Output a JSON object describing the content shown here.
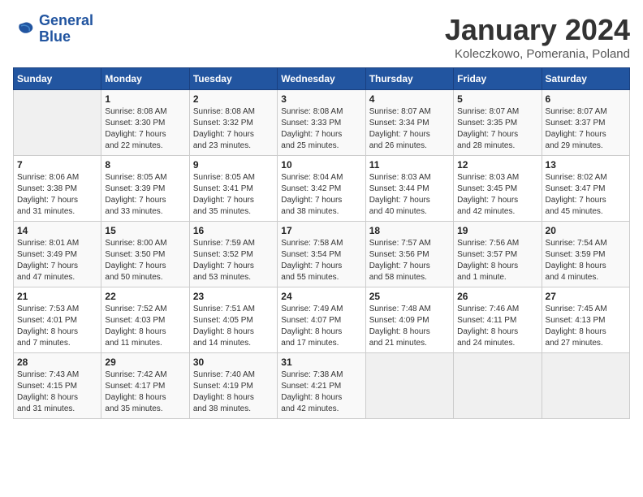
{
  "logo": {
    "line1": "General",
    "line2": "Blue"
  },
  "title": "January 2024",
  "subtitle": "Koleczkowo, Pomerania, Poland",
  "days_of_week": [
    "Sunday",
    "Monday",
    "Tuesday",
    "Wednesday",
    "Thursday",
    "Friday",
    "Saturday"
  ],
  "weeks": [
    [
      {
        "num": "",
        "info": ""
      },
      {
        "num": "1",
        "info": "Sunrise: 8:08 AM\nSunset: 3:30 PM\nDaylight: 7 hours\nand 22 minutes."
      },
      {
        "num": "2",
        "info": "Sunrise: 8:08 AM\nSunset: 3:32 PM\nDaylight: 7 hours\nand 23 minutes."
      },
      {
        "num": "3",
        "info": "Sunrise: 8:08 AM\nSunset: 3:33 PM\nDaylight: 7 hours\nand 25 minutes."
      },
      {
        "num": "4",
        "info": "Sunrise: 8:07 AM\nSunset: 3:34 PM\nDaylight: 7 hours\nand 26 minutes."
      },
      {
        "num": "5",
        "info": "Sunrise: 8:07 AM\nSunset: 3:35 PM\nDaylight: 7 hours\nand 28 minutes."
      },
      {
        "num": "6",
        "info": "Sunrise: 8:07 AM\nSunset: 3:37 PM\nDaylight: 7 hours\nand 29 minutes."
      }
    ],
    [
      {
        "num": "7",
        "info": "Sunrise: 8:06 AM\nSunset: 3:38 PM\nDaylight: 7 hours\nand 31 minutes."
      },
      {
        "num": "8",
        "info": "Sunrise: 8:05 AM\nSunset: 3:39 PM\nDaylight: 7 hours\nand 33 minutes."
      },
      {
        "num": "9",
        "info": "Sunrise: 8:05 AM\nSunset: 3:41 PM\nDaylight: 7 hours\nand 35 minutes."
      },
      {
        "num": "10",
        "info": "Sunrise: 8:04 AM\nSunset: 3:42 PM\nDaylight: 7 hours\nand 38 minutes."
      },
      {
        "num": "11",
        "info": "Sunrise: 8:03 AM\nSunset: 3:44 PM\nDaylight: 7 hours\nand 40 minutes."
      },
      {
        "num": "12",
        "info": "Sunrise: 8:03 AM\nSunset: 3:45 PM\nDaylight: 7 hours\nand 42 minutes."
      },
      {
        "num": "13",
        "info": "Sunrise: 8:02 AM\nSunset: 3:47 PM\nDaylight: 7 hours\nand 45 minutes."
      }
    ],
    [
      {
        "num": "14",
        "info": "Sunrise: 8:01 AM\nSunset: 3:49 PM\nDaylight: 7 hours\nand 47 minutes."
      },
      {
        "num": "15",
        "info": "Sunrise: 8:00 AM\nSunset: 3:50 PM\nDaylight: 7 hours\nand 50 minutes."
      },
      {
        "num": "16",
        "info": "Sunrise: 7:59 AM\nSunset: 3:52 PM\nDaylight: 7 hours\nand 53 minutes."
      },
      {
        "num": "17",
        "info": "Sunrise: 7:58 AM\nSunset: 3:54 PM\nDaylight: 7 hours\nand 55 minutes."
      },
      {
        "num": "18",
        "info": "Sunrise: 7:57 AM\nSunset: 3:56 PM\nDaylight: 7 hours\nand 58 minutes."
      },
      {
        "num": "19",
        "info": "Sunrise: 7:56 AM\nSunset: 3:57 PM\nDaylight: 8 hours\nand 1 minute."
      },
      {
        "num": "20",
        "info": "Sunrise: 7:54 AM\nSunset: 3:59 PM\nDaylight: 8 hours\nand 4 minutes."
      }
    ],
    [
      {
        "num": "21",
        "info": "Sunrise: 7:53 AM\nSunset: 4:01 PM\nDaylight: 8 hours\nand 7 minutes."
      },
      {
        "num": "22",
        "info": "Sunrise: 7:52 AM\nSunset: 4:03 PM\nDaylight: 8 hours\nand 11 minutes."
      },
      {
        "num": "23",
        "info": "Sunrise: 7:51 AM\nSunset: 4:05 PM\nDaylight: 8 hours\nand 14 minutes."
      },
      {
        "num": "24",
        "info": "Sunrise: 7:49 AM\nSunset: 4:07 PM\nDaylight: 8 hours\nand 17 minutes."
      },
      {
        "num": "25",
        "info": "Sunrise: 7:48 AM\nSunset: 4:09 PM\nDaylight: 8 hours\nand 21 minutes."
      },
      {
        "num": "26",
        "info": "Sunrise: 7:46 AM\nSunset: 4:11 PM\nDaylight: 8 hours\nand 24 minutes."
      },
      {
        "num": "27",
        "info": "Sunrise: 7:45 AM\nSunset: 4:13 PM\nDaylight: 8 hours\nand 27 minutes."
      }
    ],
    [
      {
        "num": "28",
        "info": "Sunrise: 7:43 AM\nSunset: 4:15 PM\nDaylight: 8 hours\nand 31 minutes."
      },
      {
        "num": "29",
        "info": "Sunrise: 7:42 AM\nSunset: 4:17 PM\nDaylight: 8 hours\nand 35 minutes."
      },
      {
        "num": "30",
        "info": "Sunrise: 7:40 AM\nSunset: 4:19 PM\nDaylight: 8 hours\nand 38 minutes."
      },
      {
        "num": "31",
        "info": "Sunrise: 7:38 AM\nSunset: 4:21 PM\nDaylight: 8 hours\nand 42 minutes."
      },
      {
        "num": "",
        "info": ""
      },
      {
        "num": "",
        "info": ""
      },
      {
        "num": "",
        "info": ""
      }
    ]
  ]
}
